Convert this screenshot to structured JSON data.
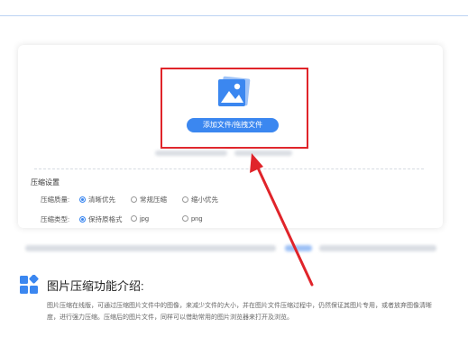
{
  "upload": {
    "button_label": "添加文件/拖拽文件"
  },
  "settings": {
    "title": "压缩设置",
    "quality_label": "压缩质量:",
    "quality_options": [
      "清晰优先",
      "常规压缩",
      "缩小优先"
    ],
    "quality_selected": "清晰优先",
    "type_label": "压缩类型:",
    "type_options": [
      "保持原格式",
      "jpg",
      "png"
    ],
    "type_selected": "保持原格式"
  },
  "intro": {
    "title": "图片压缩功能介绍:",
    "text": "图片压缩在线版，可通过压缩图片文件中的图像，来减少文件的大小，并在图片文件压缩过程中，仍然保证其图片专用，或者放弃图像清晰度，进行强力压缩。压缩后的图片文件，同样可以借助常用的图片浏览器来打开及浏览。"
  },
  "colors": {
    "accent": "#3b87f0",
    "highlight_box": "#e0242a",
    "arrow": "#e0242a"
  },
  "icons": [
    "image-upload-icon",
    "grid-feature-icon",
    "red-annotation-arrow"
  ]
}
